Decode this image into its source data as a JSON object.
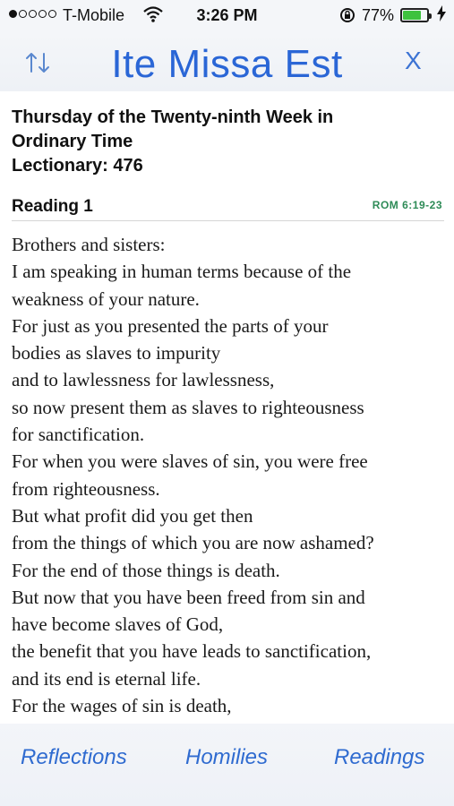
{
  "status_bar": {
    "carrier": "T-Mobile",
    "time": "3:26 PM",
    "battery_percent": "77%",
    "battery_level": 0.77,
    "signal_bars_filled": 1,
    "signal_bars_total": 5
  },
  "header": {
    "title": "Ite Missa Est",
    "close_label": "X",
    "accent_color": "#2a66d6"
  },
  "day": {
    "lines": [
      "Thursday of the Twenty-ninth Week in",
      "Ordinary Time",
      "Lectionary: 476"
    ]
  },
  "reading": {
    "label": "Reading 1",
    "citation": "ROM 6:19-23",
    "citation_color": "#2e8b57",
    "lines": [
      "Brothers and sisters:",
      "I am speaking in human terms because of the",
      "weakness of your nature.",
      "For just as you presented the parts of your",
      "bodies as slaves to impurity",
      "and to lawlessness for lawlessness,",
      "so now present them as slaves to righteousness",
      "for sanctification.",
      "For when you were slaves of sin, you were free",
      "from righteousness.",
      "But what profit did you get then",
      "from the things of which you are now ashamed?",
      "For the end of those things is death.",
      "But now that you have been freed from sin and",
      "have become slaves of God,",
      "the benefit that you have leads to sanctification,",
      "and its end is eternal life.",
      "For the wages of sin is death,"
    ]
  },
  "tabs": {
    "reflections": "Reflections",
    "homilies": "Homilies",
    "readings": "Readings"
  }
}
